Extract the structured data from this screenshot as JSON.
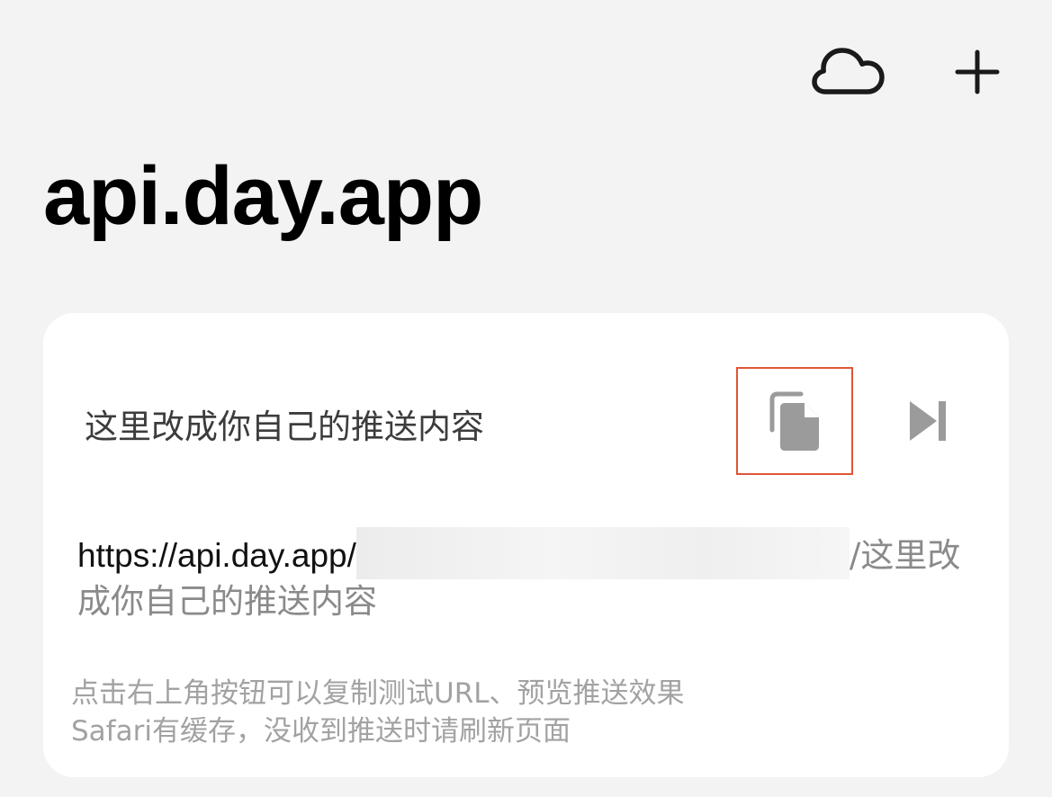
{
  "header": {
    "cloud_icon": "cloud-icon",
    "add_icon": "plus-icon"
  },
  "page": {
    "title": "api.day.app"
  },
  "card": {
    "push_title": "这里改成你自己的推送内容",
    "copy_icon": "copy-icon",
    "preview_icon": "skip-forward-icon",
    "url_prefix": "https://api.day.app/",
    "url_suffix": "/这里改成你自己的推送内容",
    "hint_line1": "点击右上角按钮可以复制测试URL、预览推送效果",
    "hint_line2": "Safari有缓存，没收到推送时请刷新页面"
  },
  "colors": {
    "background": "#f3f3f3",
    "card": "#ffffff",
    "highlight_border": "#e05536",
    "icon_gray": "#9b9b9b"
  }
}
